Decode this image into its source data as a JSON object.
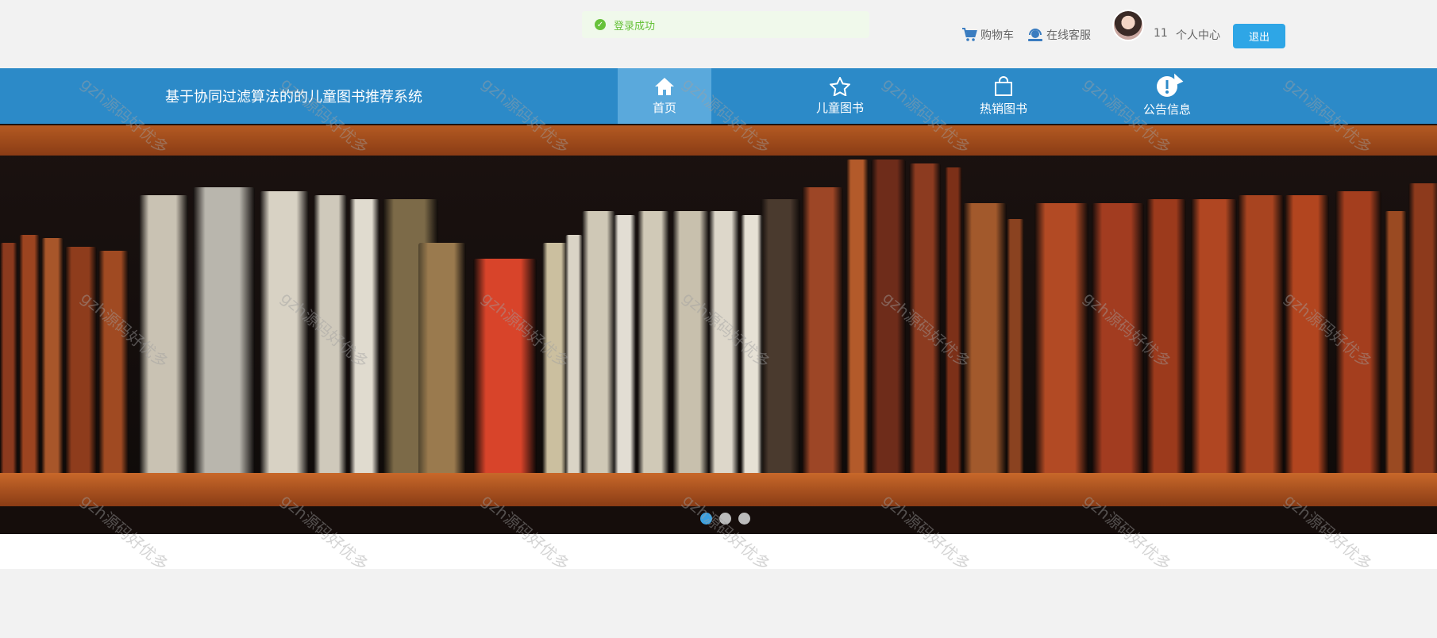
{
  "toast": {
    "message": "登录成功",
    "icon": "check-circle-icon",
    "color": "#67c23a"
  },
  "header": {
    "cart_label": "购物车",
    "service_label": "在线客服",
    "username": "11",
    "profile_label": "个人中心",
    "logout_label": "退出"
  },
  "nav": {
    "site_title": "基于协同过滤算法的的儿童图书推荐系统",
    "items": [
      {
        "label": "首页",
        "icon": "home-icon"
      },
      {
        "label": "儿童图书",
        "icon": "star-icon"
      },
      {
        "label": "热销图书",
        "icon": "shopping-bag-icon"
      },
      {
        "label": "公告信息",
        "icon": "info-icon"
      }
    ],
    "active_index": 0
  },
  "banner": {
    "slides": 3,
    "active_slide": 1
  },
  "watermark": "gzh源码好优多",
  "colors": {
    "nav": "#2c8ac8",
    "accent": "#2ea6e6",
    "success": "#67c23a"
  }
}
